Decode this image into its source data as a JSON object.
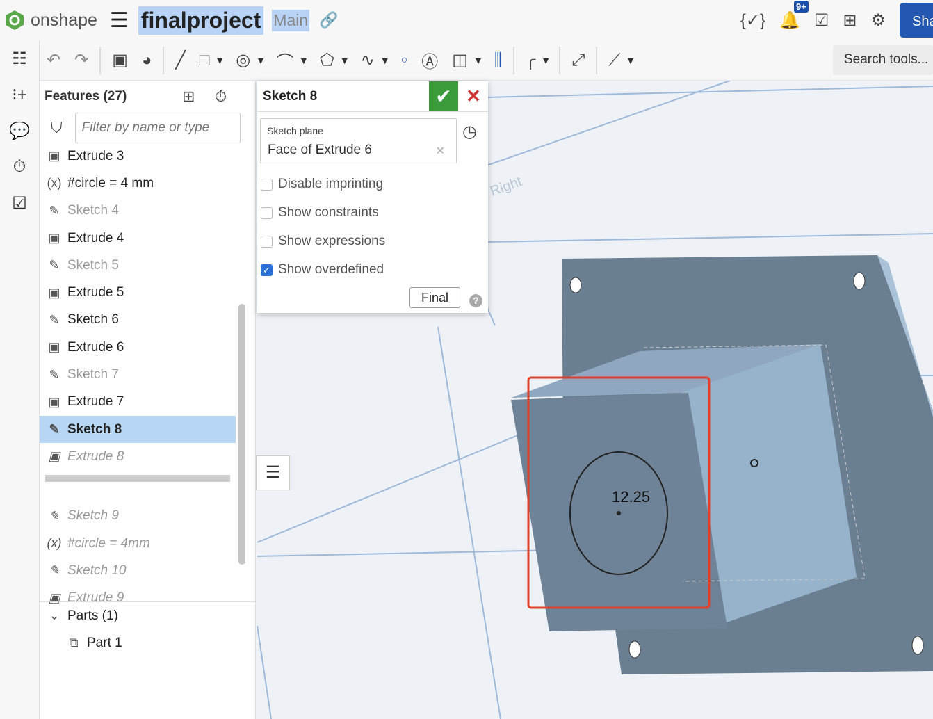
{
  "app": {
    "brand": "onshape",
    "doc_title": "finalproject",
    "branch": "Main",
    "share_label": "Sha",
    "notif_badge": "9+"
  },
  "toolbar": {
    "search_placeholder": "Search tools..."
  },
  "features": {
    "title": "Features (27)",
    "filter_placeholder": "Filter by name or type",
    "items": [
      {
        "label": "Extrude 3",
        "icon": "extrude-icon",
        "state": "normal"
      },
      {
        "label": "#circle = 4 mm",
        "icon": "variable-icon",
        "state": "normal"
      },
      {
        "label": "Sketch 4",
        "icon": "sketch-icon",
        "state": "suppressed"
      },
      {
        "label": "Extrude 4",
        "icon": "extrude-icon",
        "state": "normal"
      },
      {
        "label": "Sketch 5",
        "icon": "sketch-icon",
        "state": "suppressed"
      },
      {
        "label": "Extrude 5",
        "icon": "extrude-icon",
        "state": "normal"
      },
      {
        "label": "Sketch 6",
        "icon": "sketch-icon",
        "state": "normal"
      },
      {
        "label": "Extrude 6",
        "icon": "extrude-icon",
        "state": "normal"
      },
      {
        "label": "Sketch 7",
        "icon": "sketch-icon",
        "state": "suppressed"
      },
      {
        "label": "Extrude 7",
        "icon": "extrude-icon",
        "state": "normal"
      },
      {
        "label": "Sketch 8",
        "icon": "sketch-icon",
        "state": "selected"
      },
      {
        "label": "Extrude 8",
        "icon": "extrude-icon",
        "state": "rolled"
      }
    ],
    "after_rollback": [
      {
        "label": "Sketch 9",
        "icon": "sketch-icon"
      },
      {
        "label": "#circle = 4mm",
        "icon": "variable-icon"
      },
      {
        "label": "Sketch 10",
        "icon": "sketch-icon"
      },
      {
        "label": "Extrude 9",
        "icon": "extrude-icon"
      }
    ],
    "parts_label": "Parts (1)",
    "part": "Part 1"
  },
  "dialog": {
    "title": "Sketch 8",
    "plane_label": "Sketch plane",
    "plane_value": "Face of Extrude 6",
    "options": [
      {
        "label": "Disable imprinting",
        "checked": false
      },
      {
        "label": "Show constraints",
        "checked": false
      },
      {
        "label": "Show expressions",
        "checked": false
      },
      {
        "label": "Show overdefined",
        "checked": true
      }
    ],
    "final_label": "Final"
  },
  "viewport": {
    "dimension": "12.25",
    "plane_label": "Right",
    "highlight_color": "#e0402a",
    "accent": "#2458b0"
  }
}
